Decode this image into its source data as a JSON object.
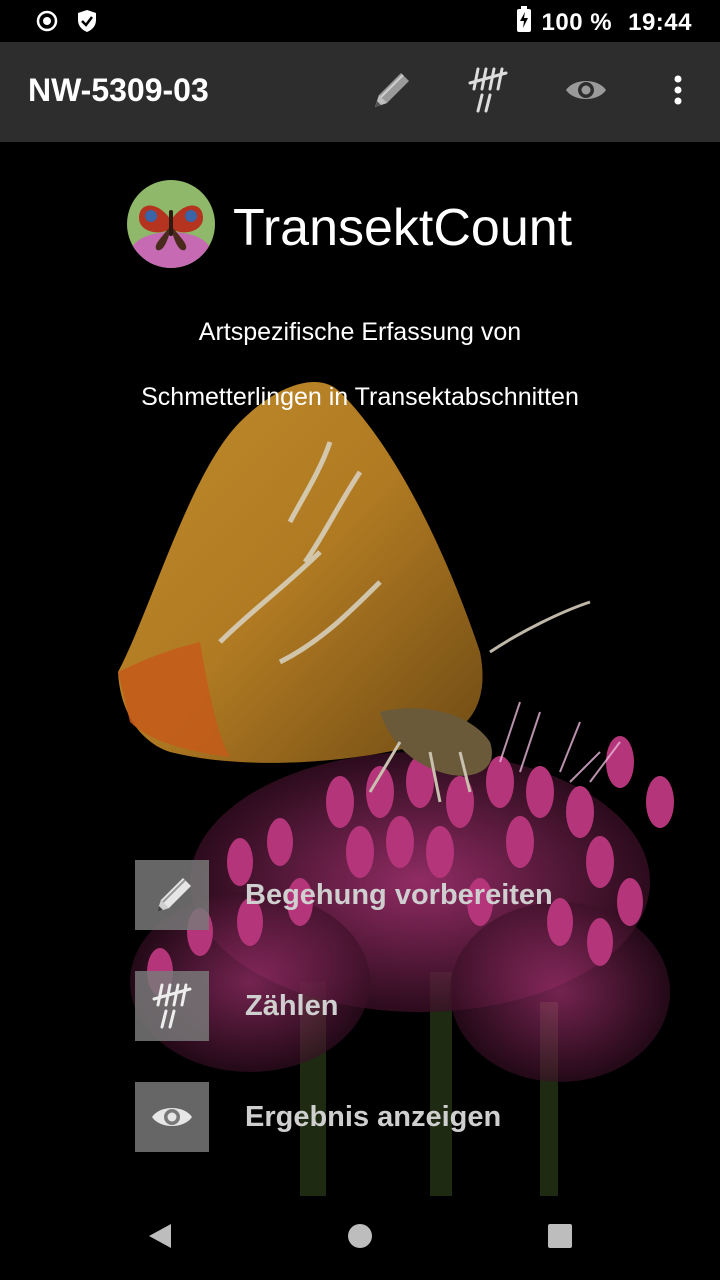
{
  "status_bar": {
    "battery_percent": "100 %",
    "time": "19:44",
    "icons": [
      "record-icon",
      "shield-icon",
      "battery-charging-icon"
    ]
  },
  "app_bar": {
    "title": "NW-5309-03",
    "actions": [
      "pencil-icon",
      "tally-icon",
      "eye-icon",
      "more-vert-icon"
    ]
  },
  "header": {
    "app_name": "TransektCount",
    "description_line1": "Artspezifische Erfassung von",
    "description_line2": "Schmetterlingen in Transektabschnitten"
  },
  "menu": [
    {
      "label": "Begehung vorbereiten",
      "icon": "pencil-icon"
    },
    {
      "label": "Zählen",
      "icon": "tally-icon"
    },
    {
      "label": "Ergebnis anzeigen",
      "icon": "eye-icon"
    }
  ],
  "nav_bar": [
    "back-icon",
    "home-icon",
    "recents-icon"
  ],
  "colors": {
    "app_bar_bg": "#2d2d2d",
    "background": "#000000",
    "menu_icon_bg": "#787878",
    "menu_label": "#cfcfcf",
    "butterfly_wing": "#b8852a",
    "flower": "#a6306e"
  }
}
